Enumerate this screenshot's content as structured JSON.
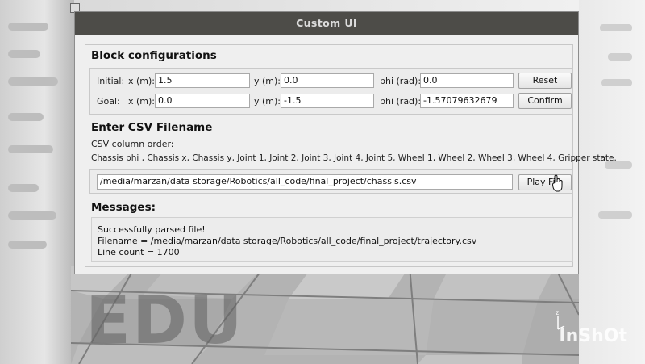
{
  "window": {
    "title": "Custom UI"
  },
  "block_config": {
    "heading": "Block configurations",
    "initial": {
      "row_label": "Initial:",
      "x_label": "x (m):",
      "x_value": "1.5",
      "y_label": "y (m):",
      "y_value": "0.0",
      "phi_label": "phi (rad):",
      "phi_value": "0.0",
      "button": "Reset"
    },
    "goal": {
      "row_label": "Goal:",
      "x_label": "x (m):",
      "x_value": "0.0",
      "y_label": "y (m):",
      "y_value": "-1.5",
      "phi_label": "phi (rad):",
      "phi_value": "-1.57079632679",
      "button": "Confirm"
    }
  },
  "csv": {
    "heading": "Enter CSV Filename",
    "order_label": "CSV column order:",
    "order_text": "Chassis phi , Chassis x, Chassis y, Joint 1, Joint 2, Joint 3, Joint 4, Joint 5, Wheel 1, Wheel 2, Wheel 3, Wheel 4, Gripper state.",
    "filename_value": "/media/marzan/data storage/Robotics/all_code/final_project/chassis.csv",
    "play_button": "Play File"
  },
  "messages": {
    "heading": "Messages:",
    "lines": [
      "Successfully parsed file!",
      "Filename = /media/marzan/data storage/Robotics/all_code/final_project/trajectory.csv",
      "Line count = 1700"
    ]
  },
  "watermarks": {
    "left": "EDU",
    "right": "InShOt"
  },
  "axis_label": "z",
  "colors": {
    "titlebar": "#4d4c48",
    "dialog_bg": "#efefef",
    "floor": "#a7a7a7"
  }
}
